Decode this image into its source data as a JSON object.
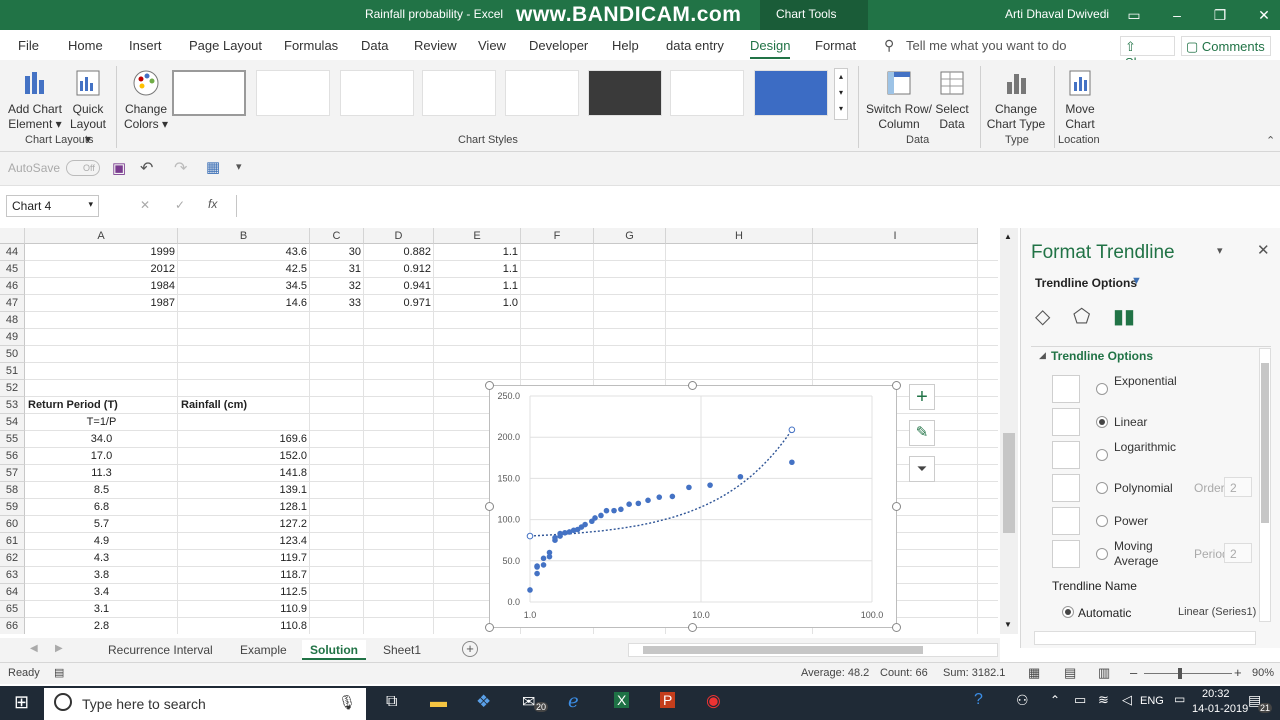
{
  "window": {
    "title": "Rainfall probability  -  Excel",
    "watermark": "www.BANDICAM.com",
    "chart_tools": "Chart Tools",
    "user": "Arti Dhaval Dwivedi"
  },
  "tabs": [
    "File",
    "Home",
    "Insert",
    "Page Layout",
    "Formulas",
    "Data",
    "Review",
    "View",
    "Developer",
    "Help",
    "data entry",
    "Design",
    "Format"
  ],
  "active_tab": "Design",
  "tell_me": "Tell me what you want to do",
  "share": "Share",
  "comments": "Comments",
  "ribbon": {
    "add_chart_element": [
      "Add Chart",
      "Element"
    ],
    "quick_layout": [
      "Quick",
      "Layout"
    ],
    "change_colors": [
      "Change",
      "Colors"
    ],
    "switch_row_col": [
      "Switch Row/",
      "Column"
    ],
    "select_data": [
      "Select",
      "Data"
    ],
    "change_chart_type": [
      "Change",
      "Chart Type"
    ],
    "move_chart": [
      "Move",
      "Chart"
    ],
    "groups": {
      "chart_layouts": "Chart Layouts",
      "chart_styles": "Chart Styles",
      "data": "Data",
      "type": "Type",
      "location": "Location"
    }
  },
  "qat": {
    "autosave": "AutoSave",
    "autosave_state": "Off"
  },
  "namebox": "Chart 4",
  "fx": "fx",
  "columns": [
    "A",
    "B",
    "C",
    "D",
    "E",
    "F",
    "G",
    "H",
    "I"
  ],
  "rows": [
    {
      "n": "44",
      "A": "1999",
      "B": "43.6",
      "C": "30",
      "D": "0.882",
      "E": "1.1"
    },
    {
      "n": "45",
      "A": "2012",
      "B": "42.5",
      "C": "31",
      "D": "0.912",
      "E": "1.1"
    },
    {
      "n": "46",
      "A": "1984",
      "B": "34.5",
      "C": "32",
      "D": "0.941",
      "E": "1.1"
    },
    {
      "n": "47",
      "A": "1987",
      "B": "14.6",
      "C": "33",
      "D": "0.971",
      "E": "1.0"
    },
    {
      "n": "48"
    },
    {
      "n": "49"
    },
    {
      "n": "50"
    },
    {
      "n": "51"
    },
    {
      "n": "52"
    },
    {
      "n": "53",
      "A": "Return Period (T)",
      "B": "Rainfall (cm)"
    },
    {
      "n": "54",
      "A": "T=1/P"
    },
    {
      "n": "55",
      "A": "34.0",
      "B": "169.6"
    },
    {
      "n": "56",
      "A": "17.0",
      "B": "152.0"
    },
    {
      "n": "57",
      "A": "11.3",
      "B": "141.8"
    },
    {
      "n": "58",
      "A": "8.5",
      "B": "139.1"
    },
    {
      "n": "59",
      "A": "6.8",
      "B": "128.1"
    },
    {
      "n": "60",
      "A": "5.7",
      "B": "127.2"
    },
    {
      "n": "61",
      "A": "4.9",
      "B": "123.4"
    },
    {
      "n": "62",
      "A": "4.3",
      "B": "119.7"
    },
    {
      "n": "63",
      "A": "3.8",
      "B": "118.7"
    },
    {
      "n": "64",
      "A": "3.4",
      "B": "112.5"
    },
    {
      "n": "65",
      "A": "3.1",
      "B": "110.9"
    },
    {
      "n": "66",
      "A": "2.8",
      "B": "110.8"
    }
  ],
  "chart_data": {
    "type": "scatter",
    "x_scale": "log",
    "xlim": [
      1,
      100
    ],
    "ylim": [
      0,
      250
    ],
    "x_ticks": [
      "1.0",
      "10.0",
      "100.0"
    ],
    "y_ticks": [
      "0.0",
      "50.0",
      "100.0",
      "150.0",
      "200.0",
      "250.0"
    ],
    "grid": true,
    "series": [
      {
        "x": [
          34.0,
          17.0,
          11.3,
          8.5,
          6.8,
          5.7,
          4.9,
          4.3,
          3.8,
          3.4,
          3.1,
          2.8,
          2.6,
          2.4,
          2.3,
          2.1,
          2.0,
          1.9,
          1.8,
          1.7,
          1.6,
          1.5,
          1.5,
          1.4,
          1.4,
          1.3,
          1.3,
          1.2,
          1.2,
          1.1,
          1.1,
          1.1,
          1.0
        ],
        "y": [
          169.6,
          152.0,
          141.8,
          139.1,
          128.1,
          127.2,
          123.4,
          119.7,
          118.7,
          112.5,
          110.9,
          110.8,
          105.0,
          102.0,
          98.0,
          94.0,
          91.0,
          88.0,
          87.0,
          85.0,
          84.0,
          83.0,
          80.0,
          78.0,
          75.0,
          60.0,
          55.0,
          53.0,
          45.0,
          43.6,
          42.5,
          34.5,
          14.6
        ]
      }
    ],
    "trendline": {
      "type": "linear",
      "from": [
        1.0,
        80.0
      ],
      "to": [
        34.0,
        209.0
      ]
    }
  },
  "sheet_tabs": [
    "Recurrence Interval",
    "Example",
    "Solution",
    "Sheet1"
  ],
  "active_sheet": "Solution",
  "pane": {
    "title": "Format Trendline",
    "section": "Trendline Options",
    "subsection": "Trendline Options",
    "options": [
      {
        "label": "Exponential",
        "selected": false
      },
      {
        "label": "Linear",
        "selected": true
      },
      {
        "label": "Logarithmic",
        "selected": false
      },
      {
        "label": "Polynomial",
        "selected": false,
        "extra": "Order",
        "extra_val": "2"
      },
      {
        "label": "Power",
        "selected": false
      },
      {
        "label": "Moving Average",
        "selected": false,
        "extra": "Period",
        "extra_val": "2"
      }
    ],
    "trendline_name": "Trendline Name",
    "automatic": "Automatic",
    "automatic_value": "Linear (Series1)"
  },
  "status": {
    "ready": "Ready",
    "average": "Average: 48.2",
    "count": "Count: 66",
    "sum": "Sum: 3182.1",
    "zoom": "90%"
  },
  "taskbar": {
    "search": "Type here to search",
    "time": "20:32",
    "date": "14-01-2019",
    "lang": "ENG",
    "mail_badge": "20",
    "notif_badge": "21"
  }
}
